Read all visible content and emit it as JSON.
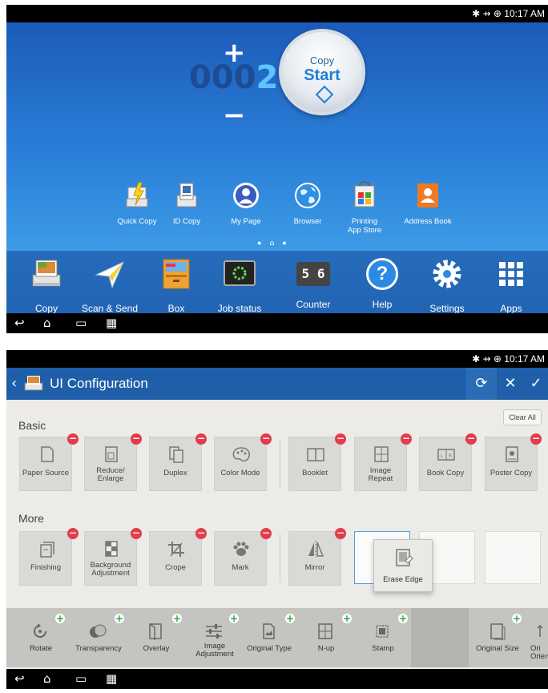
{
  "screen1": {
    "status_time": "10:17 AM",
    "status_icons": [
      "bluetooth-icon",
      "usb-icon",
      "globe-icon"
    ],
    "counter": {
      "dim_digits": "000",
      "lit_digit": "2",
      "plus": "+",
      "minus": "−"
    },
    "start_button": {
      "line1": "Copy",
      "line2": "Start"
    },
    "shortcuts": [
      {
        "label": "Quick Copy",
        "icon": "quick-copy-icon"
      },
      {
        "label": "ID Copy",
        "icon": "id-copy-icon"
      },
      {
        "label": "My Page",
        "icon": "user-icon"
      },
      {
        "label": "Browser",
        "icon": "globe-icon"
      },
      {
        "label": "Printing\nApp Store",
        "icon": "app-store-icon"
      },
      {
        "label": "Address Book",
        "icon": "address-book-icon"
      }
    ],
    "dock": [
      {
        "label": "Copy",
        "icon": "copy-icon"
      },
      {
        "label": "Scan & Send",
        "icon": "paper-plane-icon"
      },
      {
        "label": "Box",
        "icon": "box-icon"
      },
      {
        "label": "Job status",
        "icon": "job-status-icon"
      },
      {
        "label": "Counter",
        "icon": "counter-icon",
        "display": "5 6"
      },
      {
        "label": "Help",
        "icon": "help-icon",
        "glyph": "?"
      },
      {
        "label": "Settings",
        "icon": "gear-icon"
      },
      {
        "label": "Apps",
        "icon": "apps-grid-icon"
      }
    ]
  },
  "screen2": {
    "status_time": "10:17 AM",
    "title": "UI Configuration",
    "clear_all": "Clear All",
    "sections": {
      "basic": "Basic",
      "more": "More"
    },
    "basic_items": [
      {
        "label": "Paper Source"
      },
      {
        "label": "Reduce/\nEnlarge"
      },
      {
        "label": "Duplex"
      },
      {
        "label": "Color Mode"
      },
      {
        "label": "Booklet"
      },
      {
        "label": "Image\nRepeat"
      },
      {
        "label": "Book Copy"
      },
      {
        "label": "Poster Copy"
      }
    ],
    "more_items": [
      {
        "label": "Finishing"
      },
      {
        "label": "Background\nAdjustment"
      },
      {
        "label": "Crope"
      },
      {
        "label": "Mark"
      },
      {
        "label": "Mirror"
      }
    ],
    "dragging_item": "Erase Edge",
    "tray_items": [
      {
        "label": "Rotate"
      },
      {
        "label": "Transparency"
      },
      {
        "label": "Overlay"
      },
      {
        "label": "Image\nAdjustment"
      },
      {
        "label": "Original Type"
      },
      {
        "label": "N-up"
      },
      {
        "label": "Stamp"
      },
      {
        "label": "Original Size"
      },
      {
        "label": "Ori\nOrien"
      }
    ]
  },
  "colors": {
    "accent": "#1f5ea8",
    "minus_badge": "#e43c4a",
    "plus_badge": "#2faa3a",
    "home_bg": "#2a7fd8"
  }
}
